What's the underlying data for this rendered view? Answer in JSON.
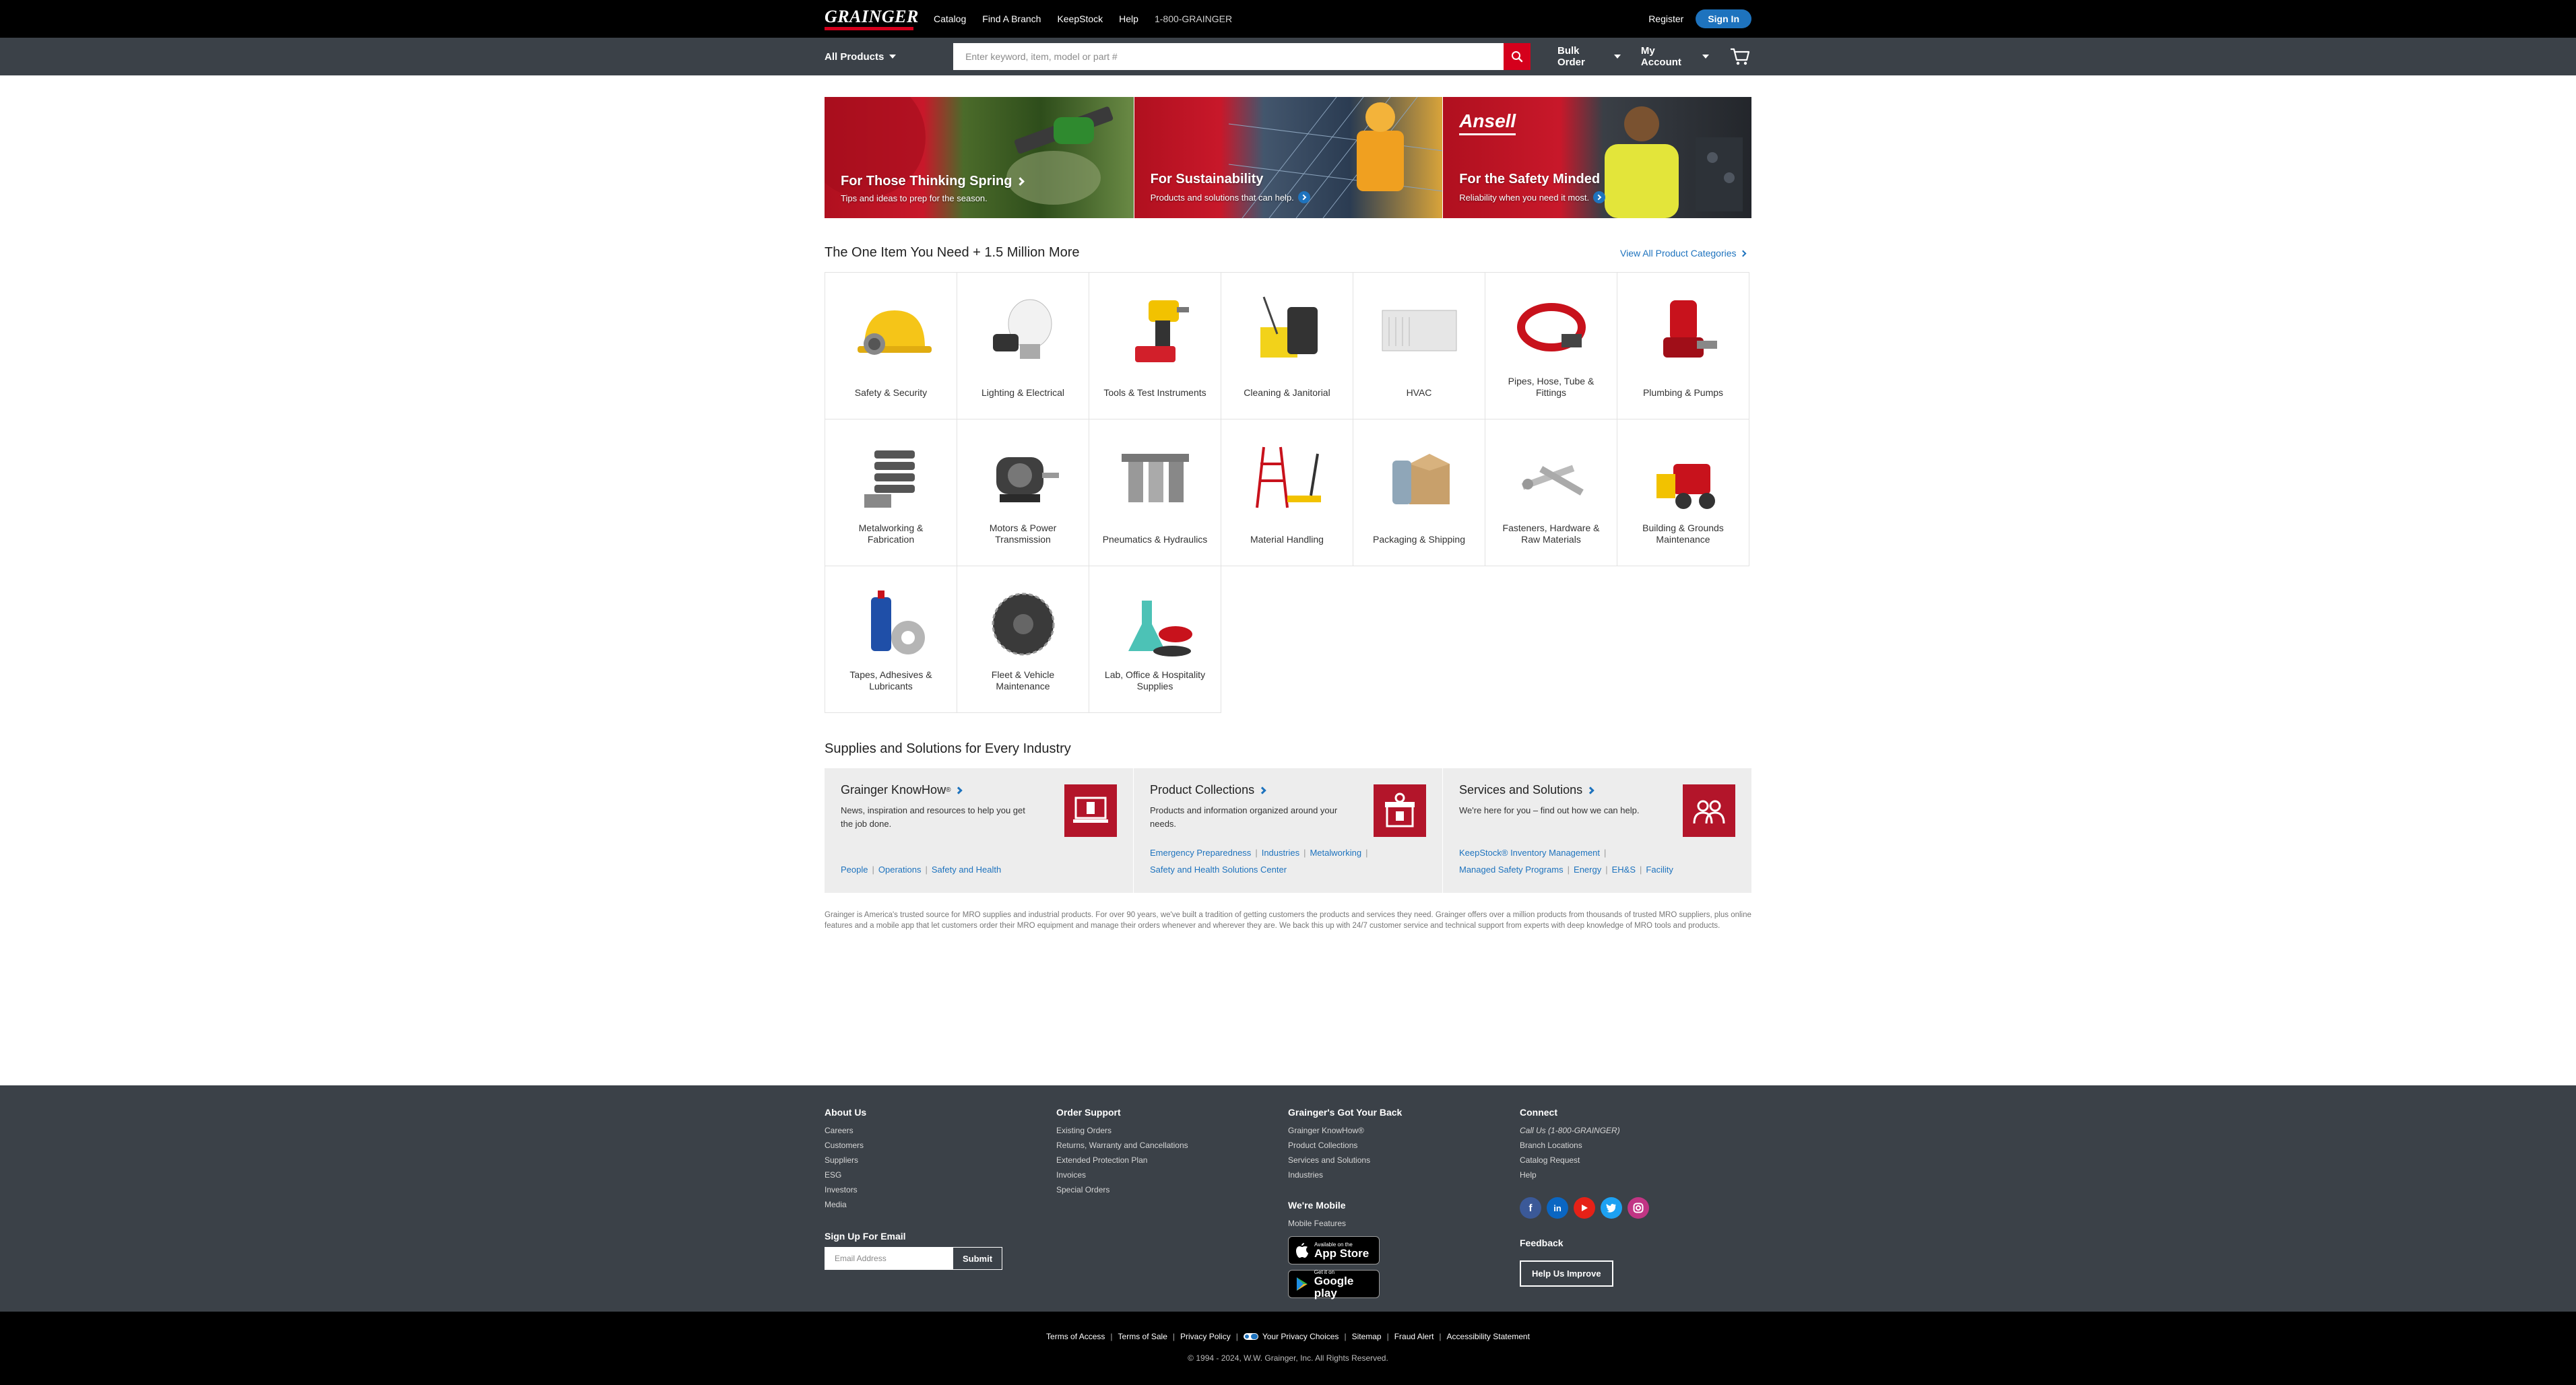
{
  "top_nav": {
    "logo_text": "GRAINGER",
    "links": [
      "Catalog",
      "Find A Branch",
      "KeepStock",
      "Help"
    ],
    "phone": "1-800-GRAINGER",
    "register": "Register",
    "sign_in": "Sign In"
  },
  "search_bar": {
    "all_products": "All Products",
    "placeholder": "Enter keyword, item, model or part #",
    "bulk_order": "Bulk Order",
    "my_account": "My Account"
  },
  "heroes": [
    {
      "title": "For Those Thinking Spring",
      "sub": "Tips and ideas to prep for the season."
    },
    {
      "title": "For Sustainability",
      "sub": "Products and solutions that can help."
    },
    {
      "title": "For the Safety Minded",
      "sub": "Reliability when you need it most.",
      "brand": "Ansell"
    }
  ],
  "categories_section": {
    "title": "The One Item You Need + 1.5 Million More",
    "view_all": "View All Product Categories",
    "items": [
      "Safety & Security",
      "Lighting & Electrical",
      "Tools & Test Instruments",
      "Cleaning & Janitorial",
      "HVAC",
      "Pipes, Hose, Tube & Fittings",
      "Plumbing & Pumps",
      "Metalworking & Fabrication",
      "Motors & Power Transmission",
      "Pneumatics & Hydraulics",
      "Material Handling",
      "Packaging & Shipping",
      "Fasteners, Hardware & Raw Materials",
      "Building & Grounds Maintenance",
      "Tapes, Adhesives & Lubricants",
      "Fleet & Vehicle Maintenance",
      "Lab, Office & Hospitality Supplies"
    ]
  },
  "solutions_section": {
    "title": "Supplies and Solutions for Every Industry",
    "cards": [
      {
        "title": "Grainger KnowHow",
        "sup": "®",
        "desc": "News, inspiration and resources to help you get the job done.",
        "links": [
          "People",
          "Operations",
          "Safety and Health"
        ]
      },
      {
        "title": "Product Collections",
        "desc": "Products and information organized around your needs.",
        "links": [
          "Emergency Preparedness",
          "Industries",
          "Metalworking",
          "Safety and Health Solutions Center"
        ]
      },
      {
        "title": "Services and Solutions",
        "desc": "We're here for you – find out how we can help.",
        "links": [
          "KeepStock® Inventory Management",
          "Managed Safety Programs",
          "Energy",
          "EH&S",
          "Facility"
        ]
      }
    ]
  },
  "blurb": "Grainger is America's trusted source for MRO supplies and industrial products. For over 90 years, we've built a tradition of getting customers the products and services they need. Grainger offers over a million products from thousands of trusted MRO suppliers, plus online features and a mobile app that let customers order their MRO equipment and manage their orders whenever and wherever they are. We back this up with 24/7 customer service and technical support from experts with deep knowledge of MRO tools and products.",
  "footer": {
    "about": {
      "title": "About Us",
      "links": [
        "Careers",
        "Customers",
        "Suppliers",
        "ESG",
        "Investors",
        "Media"
      ]
    },
    "signup": {
      "title": "Sign Up For Email",
      "placeholder": "Email Address",
      "submit": "Submit"
    },
    "order": {
      "title": "Order Support",
      "links": [
        "Existing Orders",
        "Returns, Warranty and Cancellations",
        "Extended Protection Plan",
        "Invoices",
        "Special Orders"
      ]
    },
    "back": {
      "title": "Grainger's Got Your Back",
      "links": [
        "Grainger KnowHow®",
        "Product Collections",
        "Services and Solutions",
        "Industries"
      ]
    },
    "mobile": {
      "title": "We're Mobile",
      "link": "Mobile Features",
      "appstore_small": "Available on the",
      "appstore_big": "App Store",
      "gplay_small": "Get it on",
      "gplay_big": "Google play"
    },
    "connect": {
      "title": "Connect",
      "links": [
        "Call Us (1-800-GRAINGER)",
        "Branch Locations",
        "Catalog Request",
        "Help"
      ]
    },
    "feedback": {
      "title": "Feedback",
      "button": "Help Us Improve"
    },
    "legal_links": [
      "Terms of Access",
      "Terms of Sale",
      "Privacy Policy",
      "Your Privacy Choices",
      "Sitemap",
      "Fraud Alert",
      "Accessibility Statement"
    ],
    "copyright": "© 1994 - 2024, W.W. Grainger, Inc. All Rights Reserved."
  },
  "colors": {
    "brand_red": "#d5001c",
    "link_blue": "#1e73be",
    "dark_gray": "#3b4148"
  }
}
